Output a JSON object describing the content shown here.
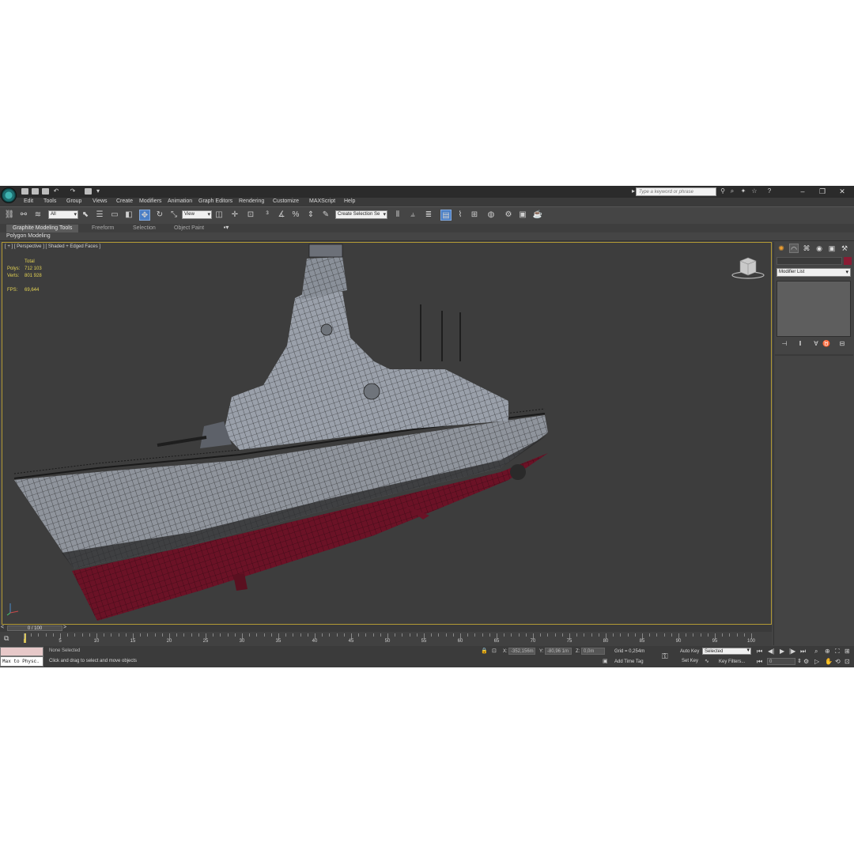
{
  "window": {
    "title_search_placeholder": "Type a keyword or phrase"
  },
  "menu": [
    "Edit",
    "Tools",
    "Group",
    "Views",
    "Create",
    "Modifiers",
    "Animation",
    "Graph Editors",
    "Rendering",
    "Customize",
    "MAXScript",
    "Help"
  ],
  "toolbar": {
    "selection_filter": "All",
    "reference_coord": "View",
    "named_selection": "Create Selection Se"
  },
  "ribbon": {
    "tabs": [
      "Graphite Modeling Tools",
      "Freeform",
      "Selection",
      "Object Paint"
    ],
    "active_tab": "Graphite Modeling Tools",
    "panel_label": "Polygon Modeling"
  },
  "viewport": {
    "label": "[ + ] [ Perspective ] [ Shaded + Edged Faces ]",
    "stats": {
      "total_label": "Total",
      "polys_label": "Polys:",
      "polys_value": "712 103",
      "verts_label": "Verts:",
      "verts_value": "801 928",
      "fps_label": "FPS:",
      "fps_value": "69,644"
    },
    "object_color": "#8a1c34"
  },
  "command_panel": {
    "modifier_list": "Modifier List"
  },
  "timeline": {
    "frame_display": "0 / 100",
    "ticks": [
      5,
      10,
      15,
      20,
      25,
      30,
      35,
      40,
      45,
      50,
      55,
      60,
      65,
      70,
      75,
      80,
      85,
      90,
      95,
      100
    ],
    "max_frame": 100
  },
  "status": {
    "maxscript_text": "Max to Physc.",
    "selection": "None Selected",
    "prompt": "Click and drag to select and move objects",
    "x_label": "X:",
    "x_value": "-352,156m",
    "y_label": "Y:",
    "y_value": "-80,96 1m",
    "z_label": "Z:",
    "z_value": "0,0m",
    "grid": "Grid = 0,254m",
    "add_time_tag": "Add Time Tag",
    "auto_key": "Auto Key",
    "set_key": "Set Key",
    "key_mode": "Selected",
    "key_filters": "Key Filters...",
    "current_frame": "0"
  },
  "icons": [
    "app-logo-icon",
    "search-icon",
    "help-icon",
    "select-move-icon",
    "rotate-icon",
    "scale-icon",
    "link-icon",
    "render-icon",
    "create-tab-icon",
    "modify-tab-icon",
    "hierarchy-tab-icon",
    "motion-tab-icon",
    "display-tab-icon",
    "utilities-tab-icon",
    "key-icon",
    "play-icon"
  ]
}
